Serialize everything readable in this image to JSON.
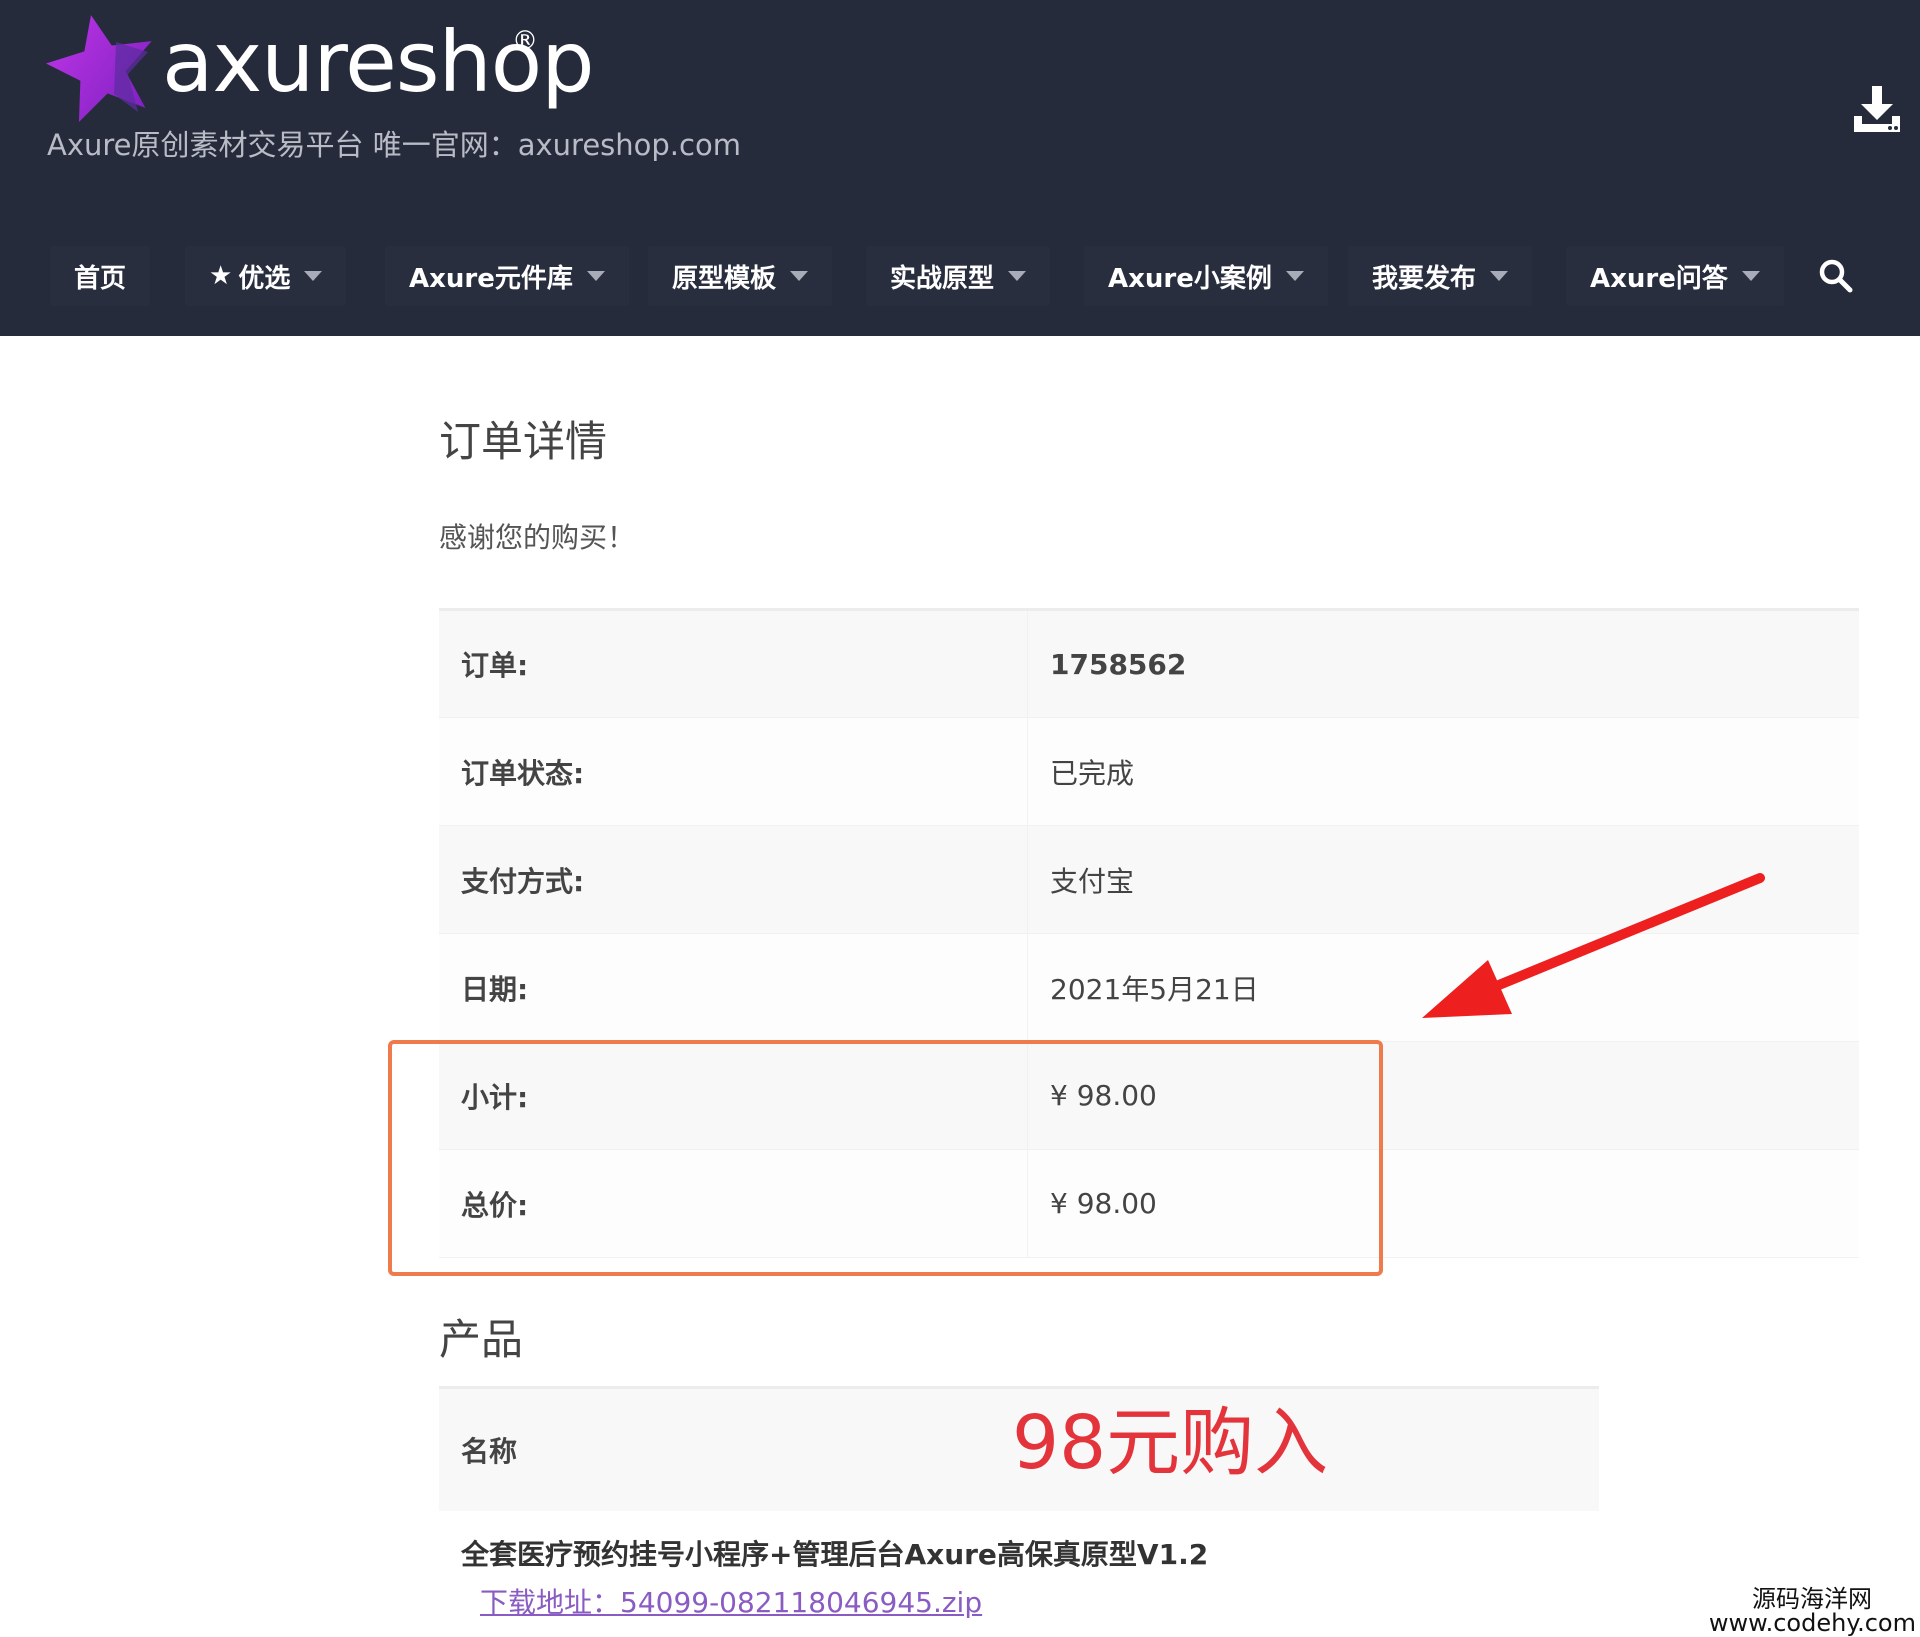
{
  "colors": {
    "header_bg": "#262b3c",
    "nav_item_bg": "#292e3f",
    "highlight_border": "#ef7a4b",
    "annotation_red": "#e3333b",
    "link": "#8a5bc2",
    "logo_purple": "#a020d0"
  },
  "header": {
    "brand": "axureshop",
    "registered_mark": "®",
    "tagline": "Axure原创素材交易平台 唯一官网：axureshop.com",
    "download_icon": "download-icon"
  },
  "nav": {
    "items": [
      {
        "label": "首页",
        "has_dropdown": false,
        "icon": null
      },
      {
        "label": "优选",
        "has_dropdown": true,
        "icon": "star-icon"
      },
      {
        "label": "Axure元件库",
        "has_dropdown": true,
        "icon": null
      },
      {
        "label": "原型模板",
        "has_dropdown": true,
        "icon": null
      },
      {
        "label": "实战原型",
        "has_dropdown": true,
        "icon": null
      },
      {
        "label": "Axure小案例",
        "has_dropdown": true,
        "icon": null
      },
      {
        "label": "我要发布",
        "has_dropdown": true,
        "icon": null
      },
      {
        "label": "Axure问答",
        "has_dropdown": true,
        "icon": null
      }
    ],
    "search_icon": "search-icon"
  },
  "order": {
    "title": "订单详情",
    "thanks": "感谢您的购买！",
    "rows": [
      {
        "label": "订单:",
        "value": "1758562"
      },
      {
        "label": "订单状态:",
        "value": "已完成"
      },
      {
        "label": "支付方式:",
        "value": "支付宝"
      },
      {
        "label": "日期:",
        "value": "2021年5月21日"
      },
      {
        "label": "小计:",
        "value": "¥ 98.00"
      },
      {
        "label": "总价:",
        "value": "¥ 98.00"
      }
    ]
  },
  "products": {
    "title": "产品",
    "column_name": "名称",
    "item_name": "全套医疗预约挂号小程序+管理后台Axure高保真原型V1.2",
    "download_label": "下载地址：54099-082118046945.zip"
  },
  "annotation": {
    "price_note": "98元购入"
  },
  "watermark": {
    "line1": "源码海洋网",
    "line2": "www.codehy.com"
  }
}
